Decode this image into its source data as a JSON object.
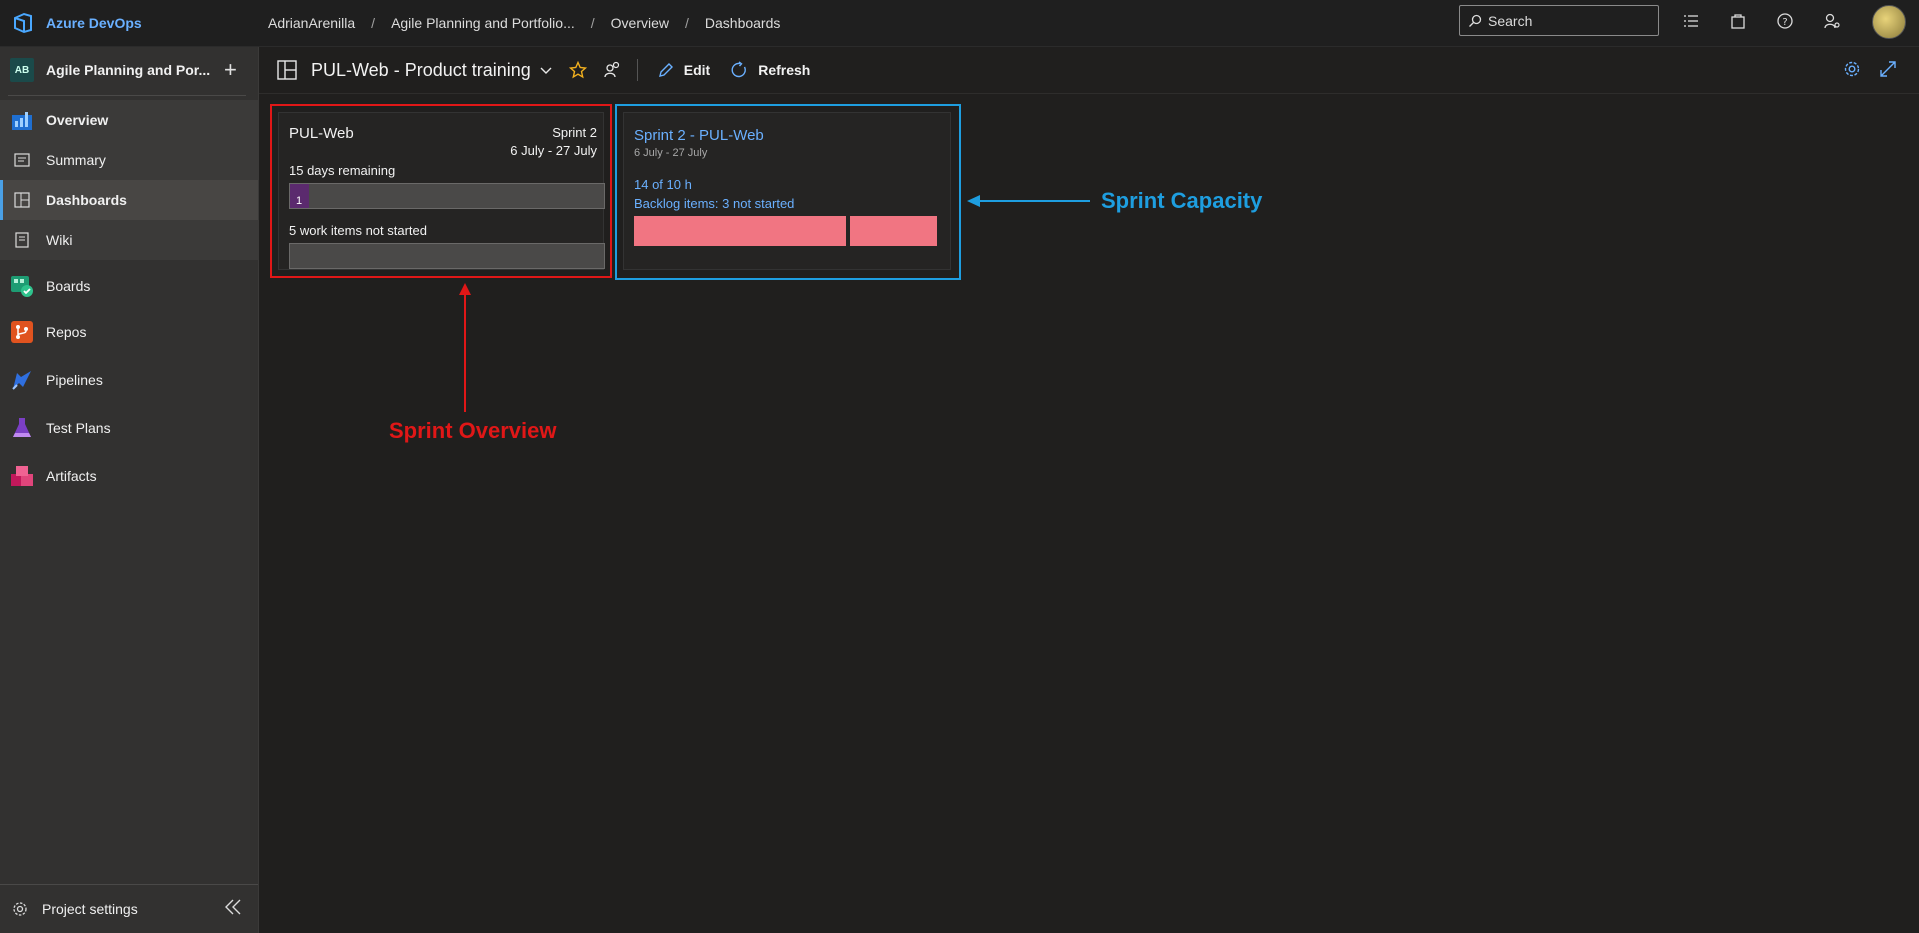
{
  "app": {
    "brand": "Azure DevOps"
  },
  "breadcrumb": [
    "AdrianArenilla",
    "Agile Planning and Portfolio...",
    "Overview",
    "Dashboards"
  ],
  "search": {
    "placeholder": "Search"
  },
  "project": {
    "initials": "AB",
    "name": "Agile Planning and Por..."
  },
  "sidebar": {
    "items": [
      {
        "label": "Overview"
      },
      {
        "label": "Summary"
      },
      {
        "label": "Dashboards"
      },
      {
        "label": "Wiki"
      },
      {
        "label": "Boards"
      },
      {
        "label": "Repos"
      },
      {
        "label": "Pipelines"
      },
      {
        "label": "Test Plans"
      },
      {
        "label": "Artifacts"
      }
    ],
    "settings_label": "Project settings"
  },
  "dashboard": {
    "title": "PUL-Web - Product training",
    "edit_label": "Edit",
    "refresh_label": "Refresh"
  },
  "sprint_overview": {
    "team": "PUL-Web",
    "sprint": "Sprint 2",
    "dates": "6 July - 27 July",
    "days_remaining": "15 days remaining",
    "bar_count": "1",
    "work_items": "5 work items not started"
  },
  "sprint_capacity": {
    "title": "Sprint 2 - PUL-Web",
    "dates": "6 July - 27 July",
    "hours": "14 of 10 h",
    "backlog": "Backlog items: 3 not started"
  },
  "annotations": {
    "overview_label": "Sprint Overview",
    "capacity_label": "Sprint Capacity",
    "overview_color": "#e01717",
    "capacity_color": "#1e9ee0"
  }
}
